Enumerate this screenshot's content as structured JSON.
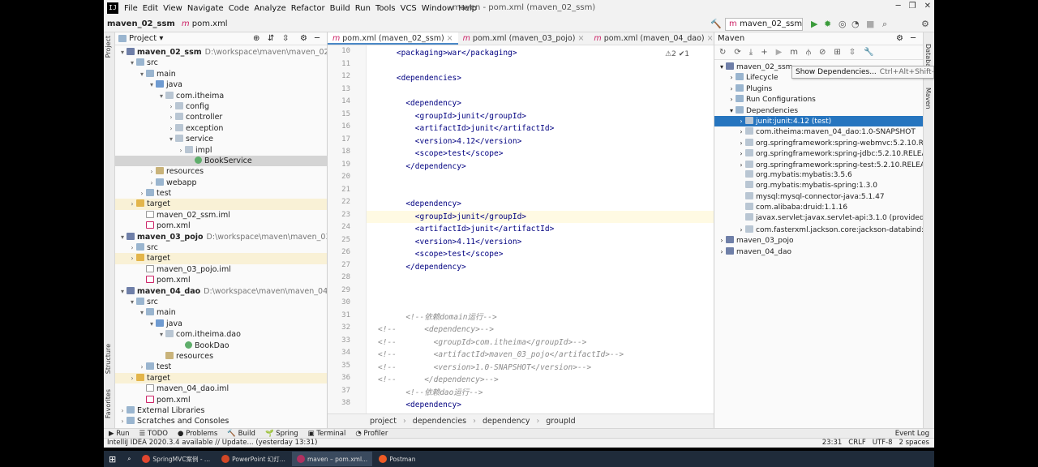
{
  "menu": [
    "File",
    "Edit",
    "View",
    "Navigate",
    "Code",
    "Analyze",
    "Refactor",
    "Build",
    "Run",
    "Tools",
    "VCS",
    "Window",
    "Help"
  ],
  "window_title": "maven - pom.xml (maven_02_ssm)",
  "breadcrumb": {
    "project": "maven_02_ssm",
    "file": "pom.xml"
  },
  "run_config": "maven_02_ssm",
  "project_panel": {
    "title": "Project",
    "rows": [
      {
        "label": "maven_02_ssm",
        "path": "D:\\workspace\\maven\\maven_02_ssm",
        "depth": 0,
        "arrow": "▾",
        "icon": "mod",
        "bold": true
      },
      {
        "label": "src",
        "depth": 1,
        "arrow": "▾",
        "icon": "folder"
      },
      {
        "label": "main",
        "depth": 2,
        "arrow": "▾",
        "icon": "folder"
      },
      {
        "label": "java",
        "depth": 3,
        "arrow": "▾",
        "icon": "src"
      },
      {
        "label": "com.itheima",
        "depth": 4,
        "arrow": "▾",
        "icon": "pkg"
      },
      {
        "label": "config",
        "depth": 5,
        "arrow": "›",
        "icon": "pkg"
      },
      {
        "label": "controller",
        "depth": 5,
        "arrow": "›",
        "icon": "pkg"
      },
      {
        "label": "exception",
        "depth": 5,
        "arrow": "›",
        "icon": "pkg"
      },
      {
        "label": "service",
        "depth": 5,
        "arrow": "▾",
        "icon": "pkg"
      },
      {
        "label": "impl",
        "depth": 6,
        "arrow": "›",
        "icon": "pkg"
      },
      {
        "label": "BookService",
        "depth": 7,
        "arrow": "",
        "icon": "cls",
        "selected": true
      },
      {
        "label": "resources",
        "depth": 3,
        "arrow": "›",
        "icon": "res"
      },
      {
        "label": "webapp",
        "depth": 3,
        "arrow": "›",
        "icon": "folder"
      },
      {
        "label": "test",
        "depth": 2,
        "arrow": "›",
        "icon": "folder"
      },
      {
        "label": "target",
        "depth": 1,
        "arrow": "›",
        "icon": "tgt",
        "target": true
      },
      {
        "label": "maven_02_ssm.iml",
        "depth": 2,
        "arrow": "",
        "icon": "file"
      },
      {
        "label": "pom.xml",
        "depth": 2,
        "arrow": "",
        "icon": "xml"
      },
      {
        "label": "maven_03_pojo",
        "path": "D:\\workspace\\maven\\maven_03_pojo",
        "depth": 0,
        "arrow": "▾",
        "icon": "mod",
        "bold": true
      },
      {
        "label": "src",
        "depth": 1,
        "arrow": "›",
        "icon": "folder"
      },
      {
        "label": "target",
        "depth": 1,
        "arrow": "›",
        "icon": "tgt",
        "target": true
      },
      {
        "label": "maven_03_pojo.iml",
        "depth": 2,
        "arrow": "",
        "icon": "file"
      },
      {
        "label": "pom.xml",
        "depth": 2,
        "arrow": "",
        "icon": "xml"
      },
      {
        "label": "maven_04_dao",
        "path": "D:\\workspace\\maven\\maven_04_dao",
        "depth": 0,
        "arrow": "▾",
        "icon": "mod",
        "bold": true
      },
      {
        "label": "src",
        "depth": 1,
        "arrow": "▾",
        "icon": "folder"
      },
      {
        "label": "main",
        "depth": 2,
        "arrow": "▾",
        "icon": "folder"
      },
      {
        "label": "java",
        "depth": 3,
        "arrow": "▾",
        "icon": "src"
      },
      {
        "label": "com.itheima.dao",
        "depth": 4,
        "arrow": "▾",
        "icon": "pkg"
      },
      {
        "label": "BookDao",
        "depth": 6,
        "arrow": "",
        "icon": "cls"
      },
      {
        "label": "resources",
        "depth": 4,
        "arrow": "",
        "icon": "res"
      },
      {
        "label": "test",
        "depth": 2,
        "arrow": "›",
        "icon": "folder"
      },
      {
        "label": "target",
        "depth": 1,
        "arrow": "›",
        "icon": "tgt",
        "target": true
      },
      {
        "label": "maven_04_dao.iml",
        "depth": 2,
        "arrow": "",
        "icon": "file"
      },
      {
        "label": "pom.xml",
        "depth": 2,
        "arrow": "",
        "icon": "xml"
      },
      {
        "label": "External Libraries",
        "depth": 0,
        "arrow": "›",
        "icon": "folder"
      },
      {
        "label": "Scratches and Consoles",
        "depth": 0,
        "arrow": "›",
        "icon": "folder"
      }
    ]
  },
  "editor": {
    "tabs": [
      "pom.xml (maven_02_ssm)",
      "pom.xml (maven_03_pojo)",
      "pom.xml (maven_04_dao)"
    ],
    "inspection": "⚠2 ✔1",
    "lines": [
      {
        "n": "10",
        "text": "    <packaging>war</packaging>"
      },
      {
        "n": "11",
        "text": ""
      },
      {
        "n": "12",
        "text": "    <dependencies>"
      },
      {
        "n": "13",
        "text": ""
      },
      {
        "n": "14",
        "text": "      <dependency>"
      },
      {
        "n": "15",
        "text": "        <groupId>junit</groupId>"
      },
      {
        "n": "16",
        "text": "        <artifactId>junit</artifactId>"
      },
      {
        "n": "17",
        "text": "        <version>4.12</version>"
      },
      {
        "n": "18",
        "text": "        <scope>test</scope>"
      },
      {
        "n": "19",
        "text": "      </dependency>"
      },
      {
        "n": "20",
        "text": ""
      },
      {
        "n": "21",
        "text": ""
      },
      {
        "n": "22",
        "text": "      <dependency>"
      },
      {
        "n": "23",
        "text": "        <groupId>junit</groupId>",
        "current": true
      },
      {
        "n": "24",
        "text": "        <artifactId>junit</artifactId>"
      },
      {
        "n": "25",
        "text": "        <version>4.11</version>"
      },
      {
        "n": "26",
        "text": "        <scope>test</scope>"
      },
      {
        "n": "27",
        "text": "      </dependency>"
      },
      {
        "n": "28",
        "text": ""
      },
      {
        "n": "29",
        "text": ""
      },
      {
        "n": "30",
        "text": ""
      },
      {
        "n": "31",
        "text": "      <!--依赖domain运行-->",
        "comment": true
      },
      {
        "n": "32",
        "text": "<!--      <dependency>-->",
        "comment": true
      },
      {
        "n": "33",
        "text": "<!--        <groupId>com.itheima</groupId>-->",
        "comment": true
      },
      {
        "n": "34",
        "text": "<!--        <artifactId>maven_03_pojo</artifactId>-->",
        "comment": true
      },
      {
        "n": "35",
        "text": "<!--        <version>1.0-SNAPSHOT</version>-->",
        "comment": true
      },
      {
        "n": "36",
        "text": "<!--      </dependency>-->",
        "comment": true
      },
      {
        "n": "37",
        "text": "      <!--依赖dao运行-->",
        "comment": true
      },
      {
        "n": "38",
        "text": "      <dependency>"
      }
    ],
    "status_path": [
      "project",
      "dependencies",
      "dependency",
      "groupId"
    ]
  },
  "maven_panel": {
    "title": "Maven",
    "rows": [
      {
        "label": "maven_02_ssm",
        "depth": 0,
        "arrow": "▾",
        "icon": "mod"
      },
      {
        "label": "Lifecycle",
        "depth": 1,
        "arrow": "›",
        "icon": "folder"
      },
      {
        "label": "Plugins",
        "depth": 1,
        "arrow": "›",
        "icon": "folder"
      },
      {
        "label": "Run Configurations",
        "depth": 1,
        "arrow": "›",
        "icon": "folder"
      },
      {
        "label": "Dependencies",
        "depth": 1,
        "arrow": "▾",
        "icon": "folder"
      },
      {
        "label": "junit:junit:4.12 (test)",
        "depth": 2,
        "arrow": "›",
        "icon": "pkg",
        "selected": true
      },
      {
        "label": "com.itheima:maven_04_dao:1.0-SNAPSHOT",
        "depth": 2,
        "arrow": "›",
        "icon": "pkg"
      },
      {
        "label": "org.springframework:spring-webmvc:5.2.10.RELEAS",
        "depth": 2,
        "arrow": "›",
        "icon": "pkg"
      },
      {
        "label": "org.springframework:spring-jdbc:5.2.10.RELEASE",
        "depth": 2,
        "arrow": "›",
        "icon": "pkg"
      },
      {
        "label": "org.springframework:spring-test:5.2.10.RELEASE",
        "depth": 2,
        "arrow": "›",
        "icon": "pkg"
      },
      {
        "label": "org.mybatis:mybatis:3.5.6",
        "depth": 2,
        "arrow": "",
        "icon": "pkg"
      },
      {
        "label": "org.mybatis:mybatis-spring:1.3.0",
        "depth": 2,
        "arrow": "",
        "icon": "pkg"
      },
      {
        "label": "mysql:mysql-connector-java:5.1.47",
        "depth": 2,
        "arrow": "",
        "icon": "pkg"
      },
      {
        "label": "com.alibaba:druid:1.1.16",
        "depth": 2,
        "arrow": "",
        "icon": "pkg"
      },
      {
        "label": "javax.servlet:javax.servlet-api:3.1.0 (provided)",
        "depth": 2,
        "arrow": "",
        "icon": "pkg"
      },
      {
        "label": "com.fasterxml.jackson.core:jackson-databind:2.9.0",
        "depth": 2,
        "arrow": "›",
        "icon": "pkg"
      },
      {
        "label": "maven_03_pojo",
        "depth": 0,
        "arrow": "›",
        "icon": "mod"
      },
      {
        "label": "maven_04_dao",
        "depth": 0,
        "arrow": "›",
        "icon": "mod"
      }
    ],
    "tooltip": {
      "text": "Show Dependencies...",
      "shortcut": "Ctrl+Alt+Shift+U"
    }
  },
  "side_labels": {
    "project": "Project",
    "structure": "Structure",
    "favorites": "Favorites",
    "database": "Database",
    "maven": "Maven"
  },
  "bottom_tools": [
    "▶ Run",
    "☰ TODO",
    "● Problems",
    "🔨 Build",
    "🌱 Spring",
    "▣ Terminal",
    "◔ Profiler"
  ],
  "event_log": "Event Log",
  "status": {
    "message": "IntelliJ IDEA 2020.3.4 available // Update... (yesterday 13:31)",
    "position": "23:31",
    "line_sep": "CRLF",
    "encoding": "UTF-8",
    "indent": "2 spaces"
  },
  "taskbar": [
    {
      "label": "SpringMVC案例 - ...",
      "color": "#e0462f"
    },
    {
      "label": "PowerPoint 幻灯...",
      "color": "#d24726"
    },
    {
      "label": "maven – pom.xml...",
      "color": "#b03060",
      "active": true
    },
    {
      "label": "Postman",
      "color": "#ef5b25"
    }
  ]
}
